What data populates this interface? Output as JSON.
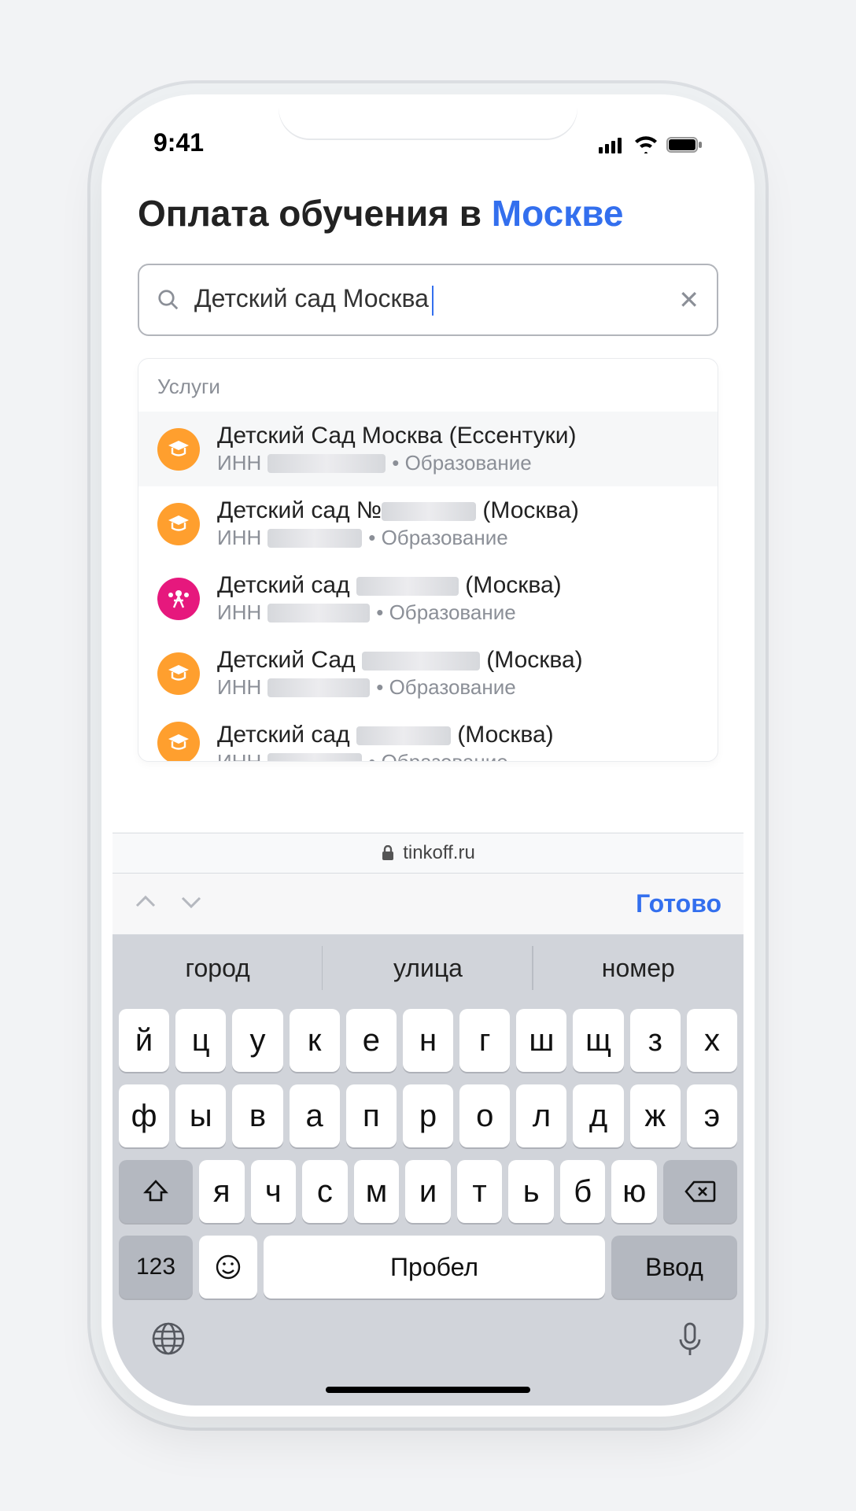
{
  "status": {
    "time": "9:41"
  },
  "page": {
    "title_prefix": "Оплата обучения в ",
    "title_city": "Москве"
  },
  "search": {
    "value": "Детский сад Москва",
    "clear_symbol": "✕"
  },
  "dropdown": {
    "section_label": "Услуги",
    "items": [
      {
        "title_a": "Детский Сад Москва (Ессентуки)",
        "title_b": "",
        "inn_label": "ИНН",
        "category": "Образование",
        "icon": "orange",
        "blur_class": "bw-lg"
      },
      {
        "title_a": "Детский сад №",
        "title_b": " (Москва)",
        "inn_label": "ИНН",
        "category": "Образование",
        "icon": "orange",
        "blur_class": "bw-sm",
        "title_blur": "bw-sm"
      },
      {
        "title_a": "Детский сад ",
        "title_b": " (Москва)",
        "inn_label": "ИНН",
        "category": "Образование",
        "icon": "magenta",
        "blur_class": "bw-md",
        "title_blur": "bw-md"
      },
      {
        "title_a": "Детский Сад ",
        "title_b": " (Москва)",
        "inn_label": "ИНН",
        "category": "Образование",
        "icon": "orange",
        "blur_class": "bw-md",
        "title_blur": "bw-lg"
      },
      {
        "title_a": "Детский сад ",
        "title_b": " (Москва)",
        "inn_label": "ИНН",
        "category": "Образование",
        "icon": "orange",
        "blur_class": "bw-sm",
        "title_blur": "bw-sm"
      }
    ]
  },
  "url_bar": {
    "domain": "tinkoff.ru"
  },
  "kb_toolbar": {
    "done": "Готово"
  },
  "suggestions": [
    "город",
    "улица",
    "номер"
  ],
  "keyboard": {
    "row1": [
      "й",
      "ц",
      "у",
      "к",
      "е",
      "н",
      "г",
      "ш",
      "щ",
      "з",
      "х"
    ],
    "row2": [
      "ф",
      "ы",
      "в",
      "а",
      "п",
      "р",
      "о",
      "л",
      "д",
      "ж",
      "э"
    ],
    "row3": [
      "я",
      "ч",
      "с",
      "м",
      "и",
      "т",
      "ь",
      "б",
      "ю"
    ],
    "num": "123",
    "space": "Пробел",
    "enter": "Ввод"
  }
}
